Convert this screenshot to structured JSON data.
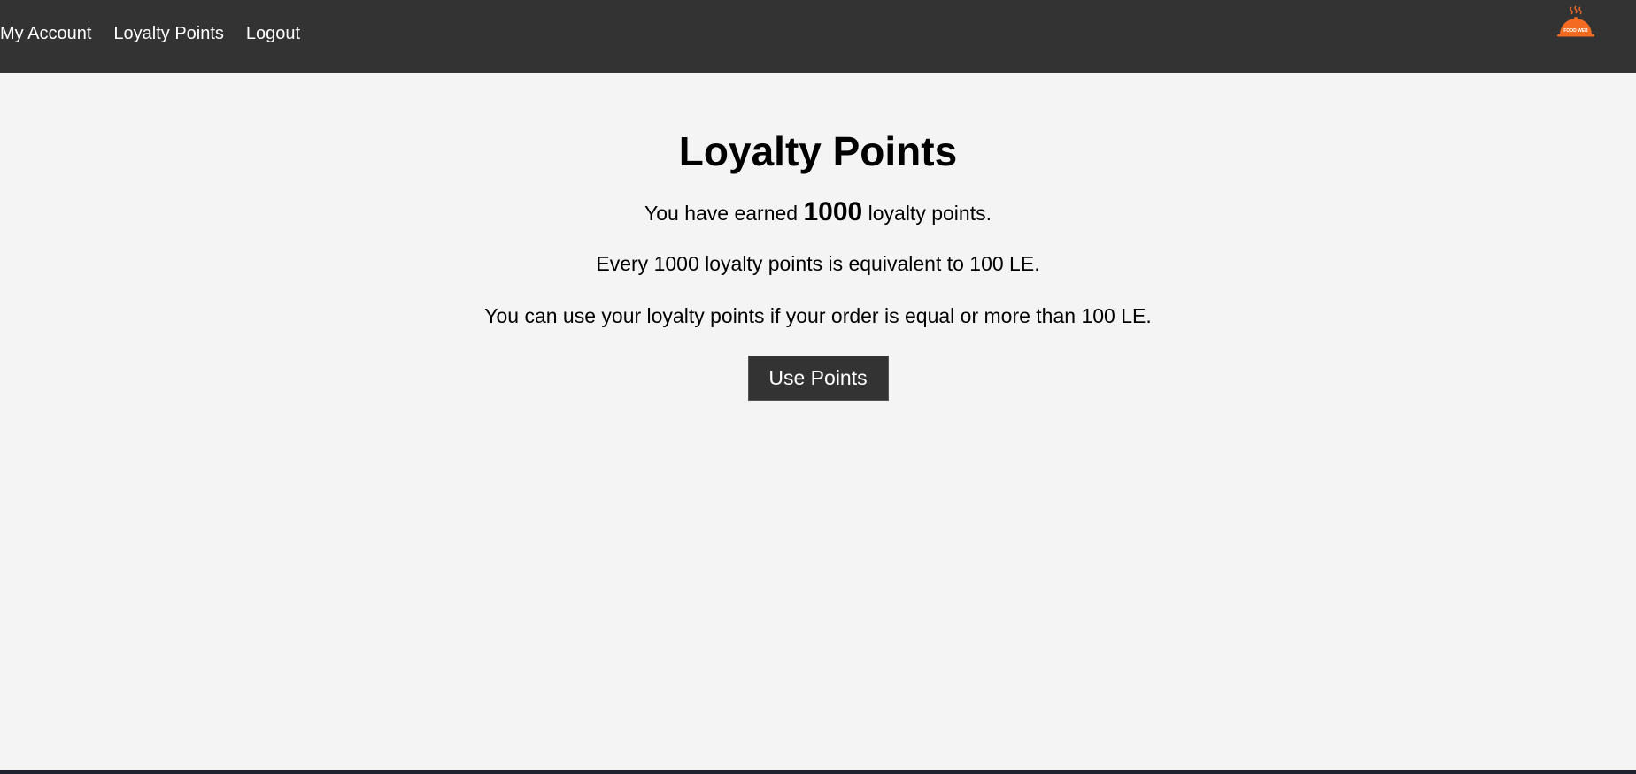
{
  "nav": {
    "links": [
      {
        "label": "My Account"
      },
      {
        "label": "Loyalty Points"
      },
      {
        "label": "Logout"
      }
    ],
    "logo_text": "FOOD WEB"
  },
  "main": {
    "title": "Loyalty Points",
    "earned_prefix": "You have earned ",
    "points": "1000",
    "earned_suffix": " loyalty points.",
    "info_1": "Every 1000 loyalty points is equivalent to 100 LE.",
    "info_2": "You can use your loyalty points if your order is equal or more than 100 LE.",
    "button_label": "Use Points"
  },
  "colors": {
    "navbar": "#333333",
    "page_background": "#f4f4f4",
    "button": "#333333",
    "logo_orange": "#f26b21"
  }
}
